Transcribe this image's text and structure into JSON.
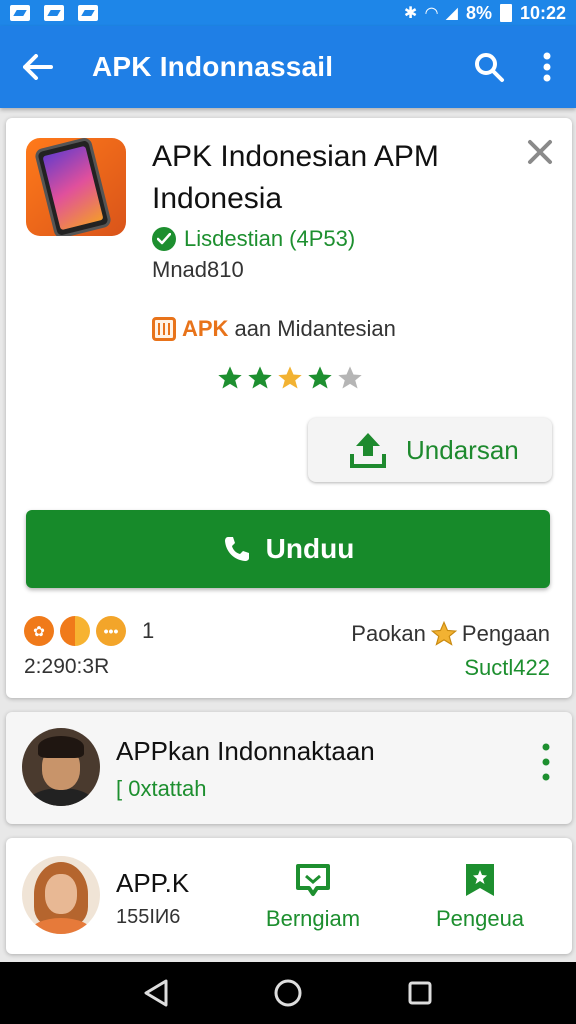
{
  "status_bar": {
    "battery": "8%",
    "time": "10:22"
  },
  "app_bar": {
    "title": "APK Indonnassail"
  },
  "app_card": {
    "name_line1": "APK Indonesian APM",
    "name_line2": "Indonesia",
    "verified_text": "Lisdestian (4P53)",
    "developer": "Mnad810",
    "apk_label": "APK",
    "apk_text": "aan Midantesian",
    "rating_stars": 3.5,
    "rating_max": 5,
    "share_label": "Undarsan",
    "install_label": "Unduu",
    "badge_count": "1",
    "size": "2:290:3R",
    "rating_label_left": "Paokan",
    "rating_label_right": "Pengaan",
    "rating_count": "Suctl422"
  },
  "publisher_card": {
    "name": "APPkan Indonnaktaan",
    "subtitle": "[ 0xtattah"
  },
  "bottom_card": {
    "name": "APP.K",
    "subtitle": "155IИ6",
    "action1_label": "Berngiam",
    "action2_label": "Pengeua"
  },
  "colors": {
    "primary_blue": "#1f7fe6",
    "green": "#178a2a",
    "orange": "#e8731a",
    "star_gold": "#f2b232"
  },
  "icons": {
    "back": "arrow-left-icon",
    "search": "search-icon",
    "more": "more-vert-icon",
    "close": "close-icon",
    "verified": "check-circle-icon",
    "share": "upload-icon",
    "install": "phone-icon",
    "nav_back": "triangle-back-icon",
    "nav_home": "circle-home-icon",
    "nav_recent": "square-recent-icon"
  }
}
